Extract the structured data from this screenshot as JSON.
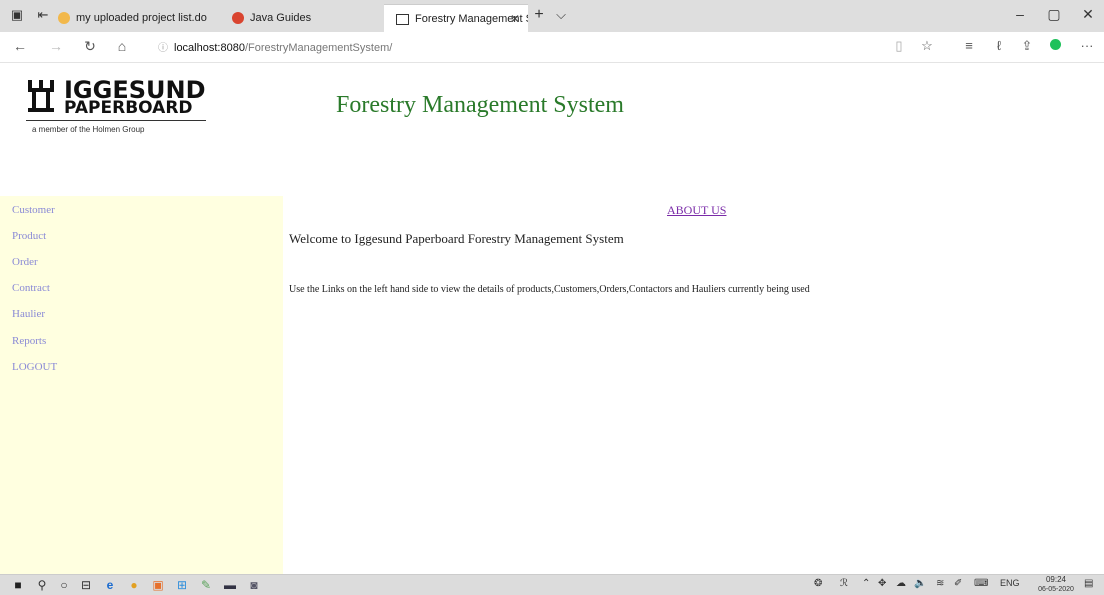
{
  "browser": {
    "tabs": [
      {
        "label": "my uploaded project list.do"
      },
      {
        "label": "Java Guides"
      },
      {
        "label": "Forestry Management S"
      }
    ],
    "url_host": "localhost:8080",
    "url_path": "/ForestryManagementSystem/"
  },
  "logo": {
    "line1": "IGGESUND",
    "line2": "PAPERBOARD",
    "tagline": "a member of the Holmen Group"
  },
  "app": {
    "title": "Forestry Management System"
  },
  "sidebar": {
    "items": [
      {
        "label": "Customer"
      },
      {
        "label": "Product"
      },
      {
        "label": "Order"
      },
      {
        "label": "Contract"
      },
      {
        "label": "Haulier"
      },
      {
        "label": "Reports"
      },
      {
        "label": "LOGOUT"
      }
    ]
  },
  "main": {
    "about_label": "ABOUT US",
    "welcome": "Welcome to Iggesund Paperboard Forestry Management System",
    "info": "Use the Links on the left hand side to view the details of products,Customers,Orders,Contactors and Hauliers currently being used"
  },
  "taskbar": {
    "lang": "ENG",
    "time": "09:24",
    "date": "06-05-2020"
  }
}
